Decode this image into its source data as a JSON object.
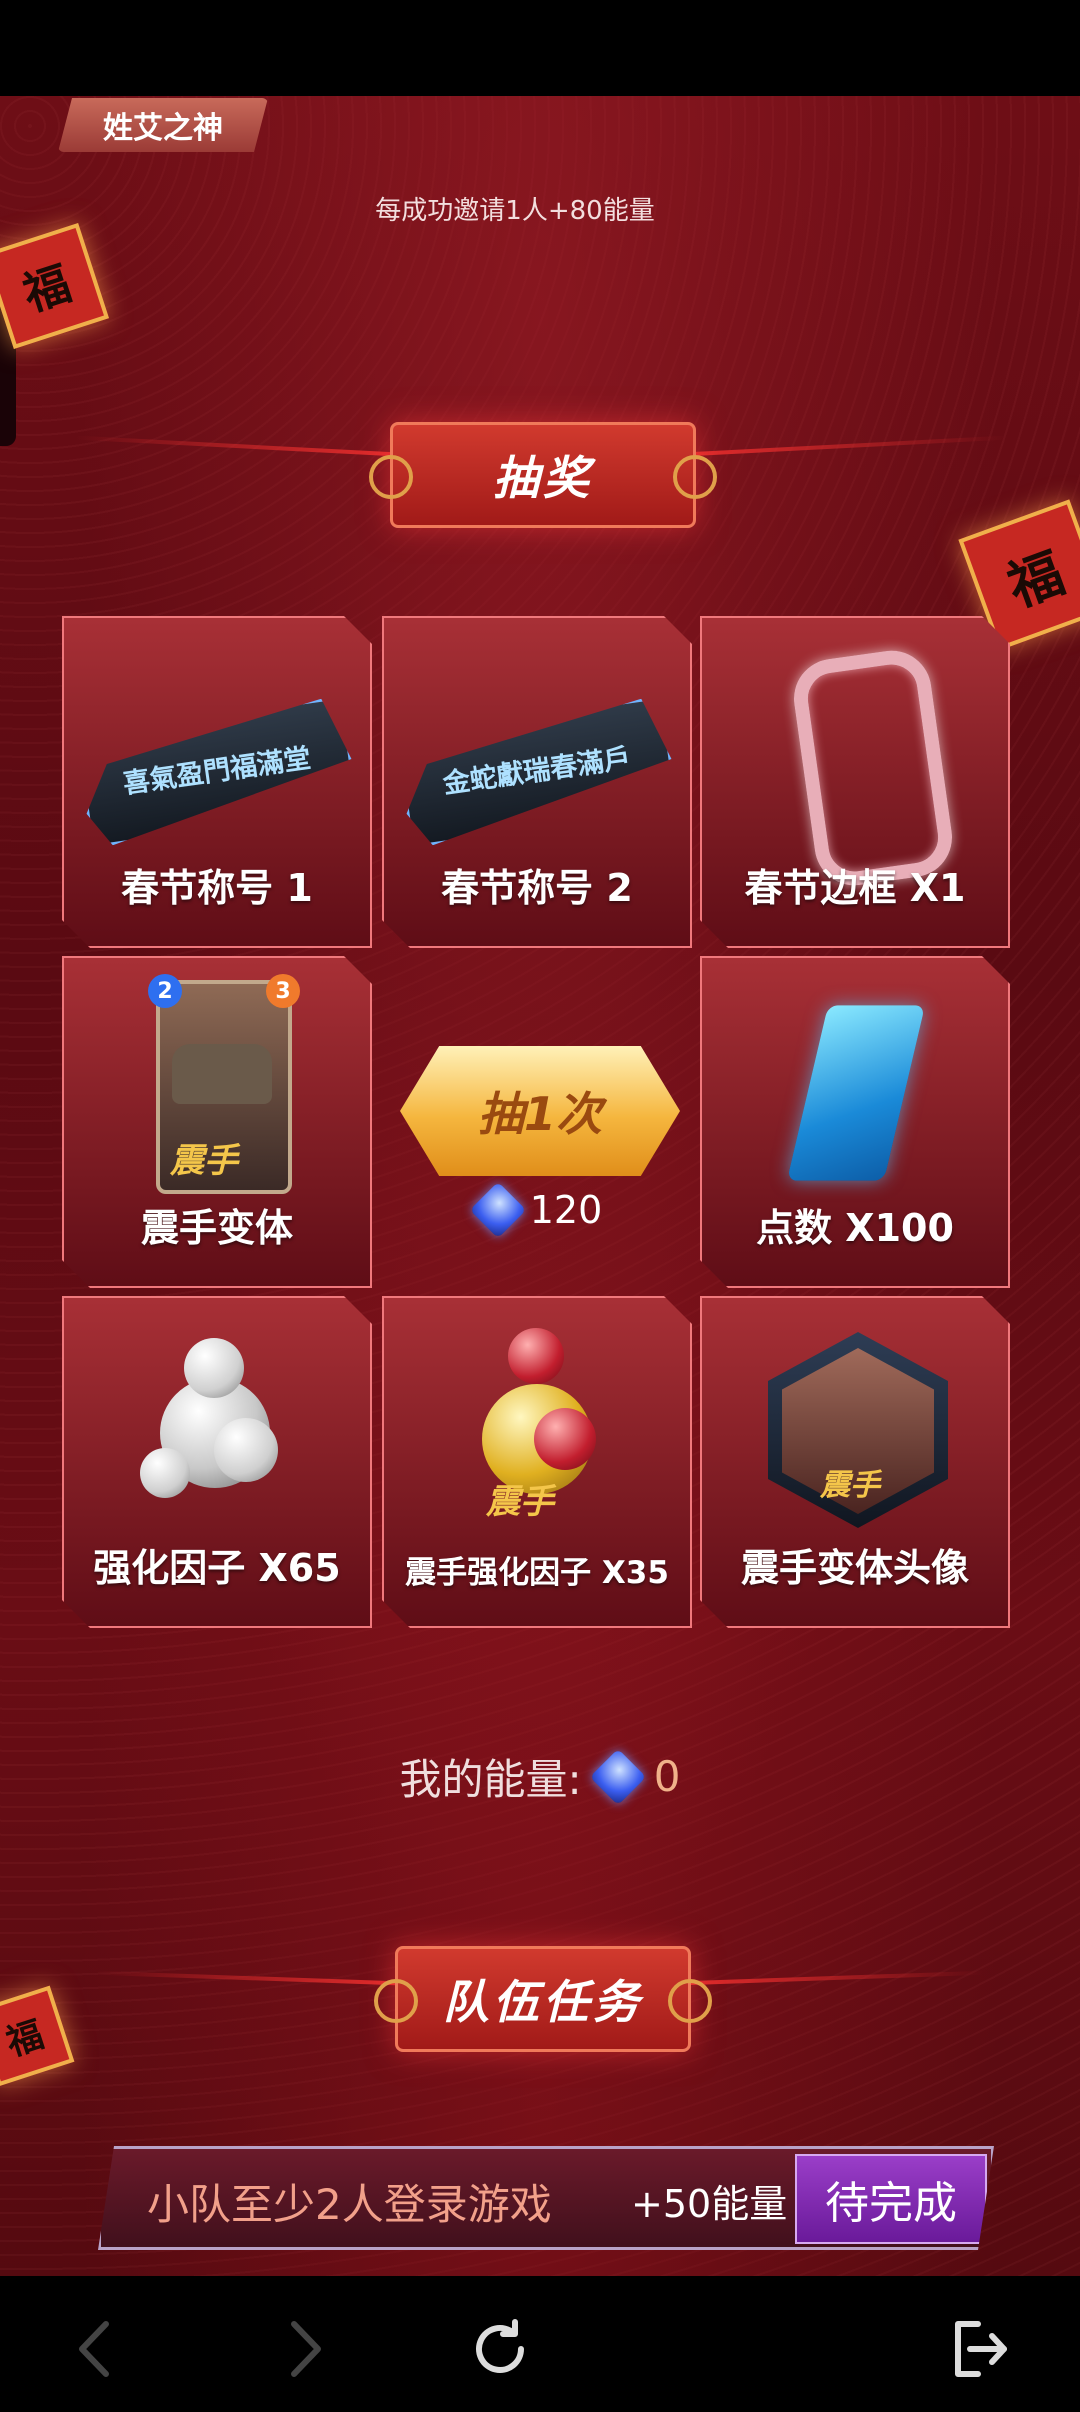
{
  "header": {
    "tag_label": "姓艾之神",
    "invite_text": "每成功邀请1人+80能量"
  },
  "decorations": {
    "fu_char": "福"
  },
  "lottery": {
    "title": "抽奖",
    "prizes": [
      {
        "label": "春节称号 1",
        "plate_text": "喜氣盈門福滿堂"
      },
      {
        "label": "春节称号 2",
        "plate_text": "金蛇獻瑞春滿戶"
      },
      {
        "label": "春节边框 X1"
      },
      {
        "label": "震手变体",
        "card_cost": "2",
        "card_power": "3",
        "card_name": "震手"
      },
      {
        "label": "点数 X100"
      },
      {
        "label": "强化因子 X65"
      },
      {
        "label": "震手强化因子 X35",
        "art_text": "震手"
      },
      {
        "label": "震手变体头像",
        "art_text": "震手"
      }
    ],
    "draw_button": "抽1次",
    "draw_cost": "120",
    "my_energy_label": "我的能量:",
    "my_energy_value": "0"
  },
  "team_tasks": {
    "title": "队伍任务",
    "tasks": [
      {
        "description": "小队至少2人登录游戏",
        "reward": "+50能量",
        "status": "待完成"
      }
    ]
  },
  "colors": {
    "background": "#5a0a12",
    "accent_red": "#e22c2c",
    "gold": "#f5b63e",
    "status_purple": "#7a28b0"
  },
  "nav": {
    "icons": [
      "back-icon",
      "forward-icon",
      "refresh-icon",
      "exit-icon"
    ]
  }
}
